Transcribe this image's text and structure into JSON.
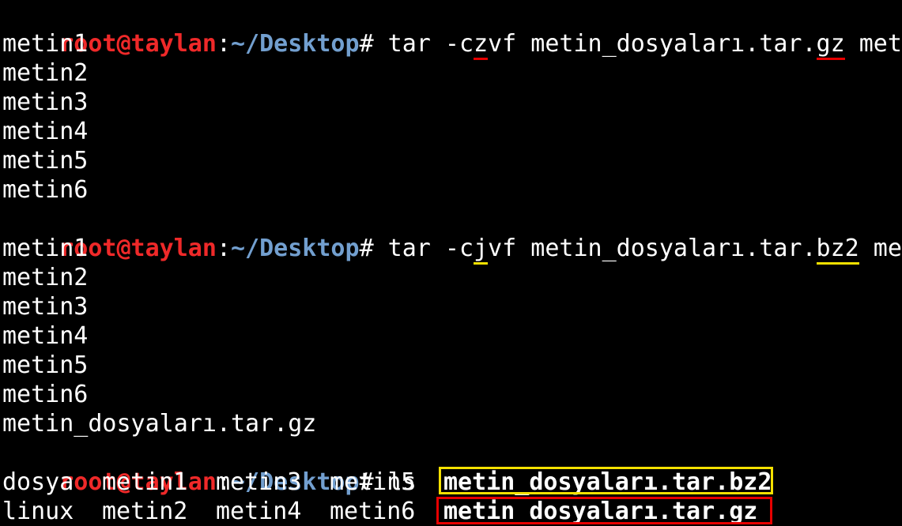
{
  "terminal": {
    "prompt": {
      "user_host": "root@taylan",
      "colon": ":",
      "path": "~/Desktop",
      "symbol": "#"
    },
    "commands": [
      {
        "text_before": " tar -c",
        "flag_letter": "z",
        "text_middle": "vf metin_dosyaları.tar.",
        "extension": "gz",
        "text_after": " metin*"
      },
      {
        "text_before": " tar -c",
        "flag_letter": "j",
        "text_middle": "vf metin_dosyaları.tar.",
        "extension": "bz2",
        "text_after": " metin*"
      },
      {
        "text": " ls"
      }
    ],
    "gz_output": [
      "metin1",
      "metin2",
      "metin3",
      "metin4",
      "metin5",
      "metin6"
    ],
    "bz2_output": [
      "metin1",
      "metin2",
      "metin3",
      "metin4",
      "metin5",
      "metin6",
      "metin_dosyaları.tar.gz"
    ],
    "ls_rows": [
      [
        "dosya",
        "metin1",
        "metin3",
        "metin5",
        "metin_dosyaları.tar.bz2"
      ],
      [
        "linux",
        "metin2",
        "metin4",
        "metin6",
        "metin_dosyaları.tar.gz"
      ]
    ],
    "colors": {
      "background": "#000000",
      "prompt_user": "#ef2929",
      "prompt_path": "#729fcf",
      "text": "#ffffff",
      "highlight_red": "#e60000",
      "highlight_yellow": "#f4e000"
    }
  }
}
